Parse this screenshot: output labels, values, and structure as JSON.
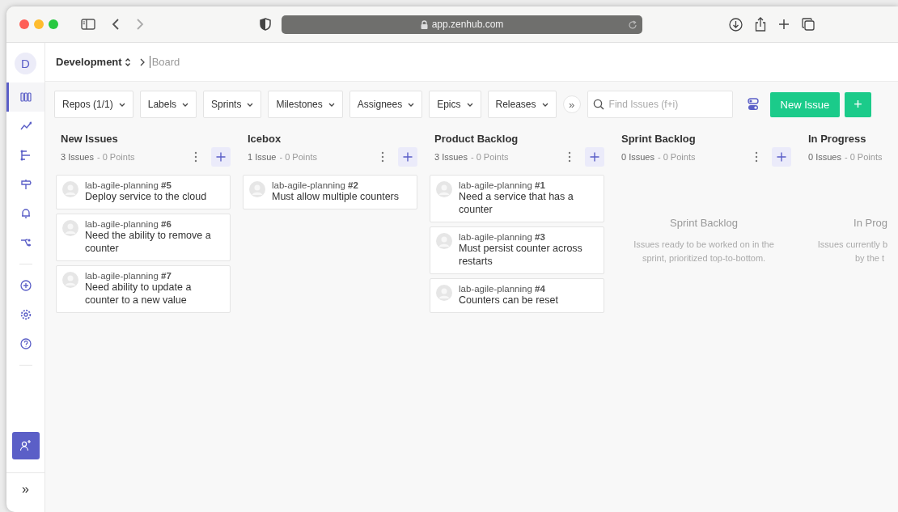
{
  "browser": {
    "url": "app.zenhub.com"
  },
  "workspace": {
    "avatar": "D",
    "name": "Development",
    "page": "Board"
  },
  "sidebar": {
    "items": [
      {
        "selected": true
      },
      {
        "selected": false
      },
      {
        "selected": false
      },
      {
        "selected": false
      },
      {
        "selected": false
      },
      {
        "selected": false
      }
    ],
    "bottom_items": [
      {
        "selected": false
      },
      {
        "selected": false
      },
      {
        "selected": false
      }
    ],
    "expand": "»"
  },
  "filters": [
    {
      "label": "Repos (1/1)"
    },
    {
      "label": "Labels"
    },
    {
      "label": "Sprints"
    },
    {
      "label": "Milestones"
    },
    {
      "label": "Assignees"
    },
    {
      "label": "Epics"
    },
    {
      "label": "Releases"
    }
  ],
  "more_filters": "»",
  "search": {
    "placeholder": "Find Issues (f+i)"
  },
  "new_issue": "New Issue",
  "add_button": "+",
  "columns": [
    {
      "title": "New Issues",
      "issues": "3 Issues",
      "points": "- 0 Points",
      "actions": true,
      "cards": [
        {
          "ref": "lab-agile-planning **#5**",
          "title": "Deploy service to the cloud"
        },
        {
          "ref": "lab-agile-planning **#6**",
          "title": "Need the ability to remove a counter"
        },
        {
          "ref": "lab-agile-planning **#7**",
          "title": "Need ability to update a counter to a new value"
        }
      ]
    },
    {
      "title": "Icebox",
      "issues": "1 Issue",
      "points": "- 0 Points",
      "actions": true,
      "cards": [
        {
          "ref": "lab-agile-planning **#2**",
          "title": "Must allow multiple counters"
        }
      ]
    },
    {
      "title": "Product Backlog",
      "issues": "3 Issues",
      "points": "- 0 Points",
      "actions": true,
      "cards": [
        {
          "ref": "lab-agile-planning **#1**",
          "title": "Need a service that has a counter"
        },
        {
          "ref": "lab-agile-planning **#3**",
          "title": "Must persist counter across restarts"
        },
        {
          "ref": "lab-agile-planning **#4**",
          "title": "Counters can be reset"
        }
      ]
    },
    {
      "title": "Sprint Backlog",
      "issues": "0 Issues",
      "points": "- 0 Points",
      "actions": true,
      "empty": {
        "title": "Sprint Backlog",
        "lines": [
          "Issues ready to be worked on in the",
          "sprint, prioritized top-to-bottom."
        ],
        "cut": false
      }
    },
    {
      "title": "In Progress",
      "issues": "0 Issues",
      "points": "- 0 Points",
      "actions": false,
      "empty": {
        "title": "In Prog",
        "lines": [
          "Issues currently b",
          "by the t"
        ],
        "cut": true
      }
    }
  ]
}
